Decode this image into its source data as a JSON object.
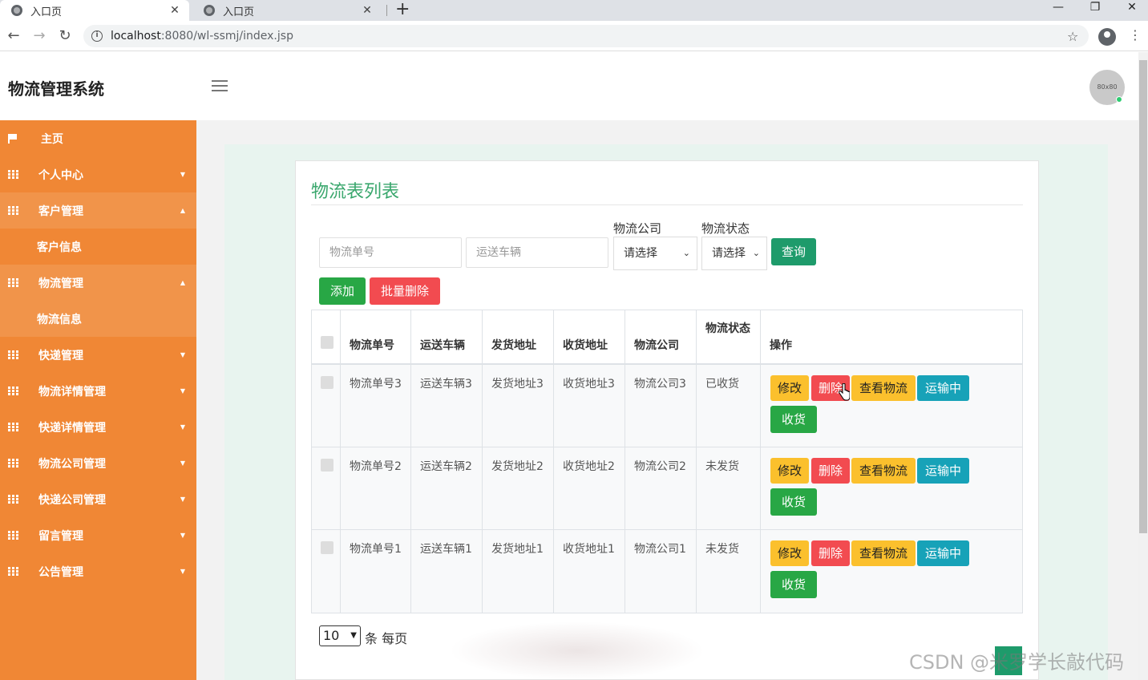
{
  "browser": {
    "tabs": [
      {
        "title": "入口页",
        "active": true
      },
      {
        "title": "入口页",
        "active": false
      }
    ],
    "url_host": "localhost",
    "url_path": ":8080/wl-ssmj/index.jsp"
  },
  "header": {
    "brand": "物流管理系统",
    "avatar_text": "80x80"
  },
  "sidebar": {
    "items": [
      {
        "label": "主页",
        "icon": "flag-icon",
        "state": "plain"
      },
      {
        "label": "个人中心",
        "icon": "grid-icon",
        "state": "collapsed"
      },
      {
        "label": "客户管理",
        "icon": "grid-icon",
        "state": "expanded"
      },
      {
        "label": "客户信息",
        "icon": "",
        "state": "sub"
      },
      {
        "label": "物流管理",
        "icon": "grid-icon",
        "state": "expanded"
      },
      {
        "label": "物流信息",
        "icon": "",
        "state": "sub"
      },
      {
        "label": "快递管理",
        "icon": "grid-icon",
        "state": "collapsed"
      },
      {
        "label": "物流详情管理",
        "icon": "grid-icon",
        "state": "collapsed"
      },
      {
        "label": "快递详情管理",
        "icon": "grid-icon",
        "state": "collapsed"
      },
      {
        "label": "物流公司管理",
        "icon": "grid-icon",
        "state": "collapsed"
      },
      {
        "label": "快递公司管理",
        "icon": "grid-icon",
        "state": "collapsed"
      },
      {
        "label": "留言管理",
        "icon": "grid-icon",
        "state": "collapsed"
      },
      {
        "label": "公告管理",
        "icon": "grid-icon",
        "state": "collapsed"
      }
    ]
  },
  "main": {
    "title": "物流表列表",
    "search": {
      "order_placeholder": "物流单号",
      "vehicle_placeholder": "运送车辆",
      "company_label": "物流公司",
      "company_value": "请选择",
      "status_label": "物流状态",
      "status_value": "请选择",
      "query_label": "查询"
    },
    "actions": {
      "add_label": "添加",
      "batch_delete_label": "批量删除"
    },
    "table": {
      "headers": [
        "物流单号",
        "运送车辆",
        "发货地址",
        "收货地址",
        "物流公司",
        "物流状态",
        "操作"
      ],
      "rows": [
        {
          "order": "物流单号3",
          "vehicle": "运送车辆3",
          "from": "发货地址3",
          "to": "收货地址3",
          "company": "物流公司3",
          "status": "已收货"
        },
        {
          "order": "物流单号2",
          "vehicle": "运送车辆2",
          "from": "发货地址2",
          "to": "收货地址2",
          "company": "物流公司2",
          "status": "未发货"
        },
        {
          "order": "物流单号1",
          "vehicle": "运送车辆1",
          "from": "发货地址1",
          "to": "收货地址1",
          "company": "物流公司1",
          "status": "未发货"
        }
      ],
      "op_labels": {
        "edit": "修改",
        "delete": "删除",
        "view": "查看物流",
        "shipping": "运输中",
        "receive": "收货"
      }
    },
    "pager": {
      "page_size": "10",
      "suffix": "条 每页"
    }
  },
  "watermark": "CSDN @米罗学长敲代码",
  "colors": {
    "sidebar": "#f08735",
    "title_green": "#3aa76d",
    "primary_green": "#28a745",
    "danger": "#f24b50",
    "warning": "#fbc02d",
    "info": "#17a2b8"
  }
}
